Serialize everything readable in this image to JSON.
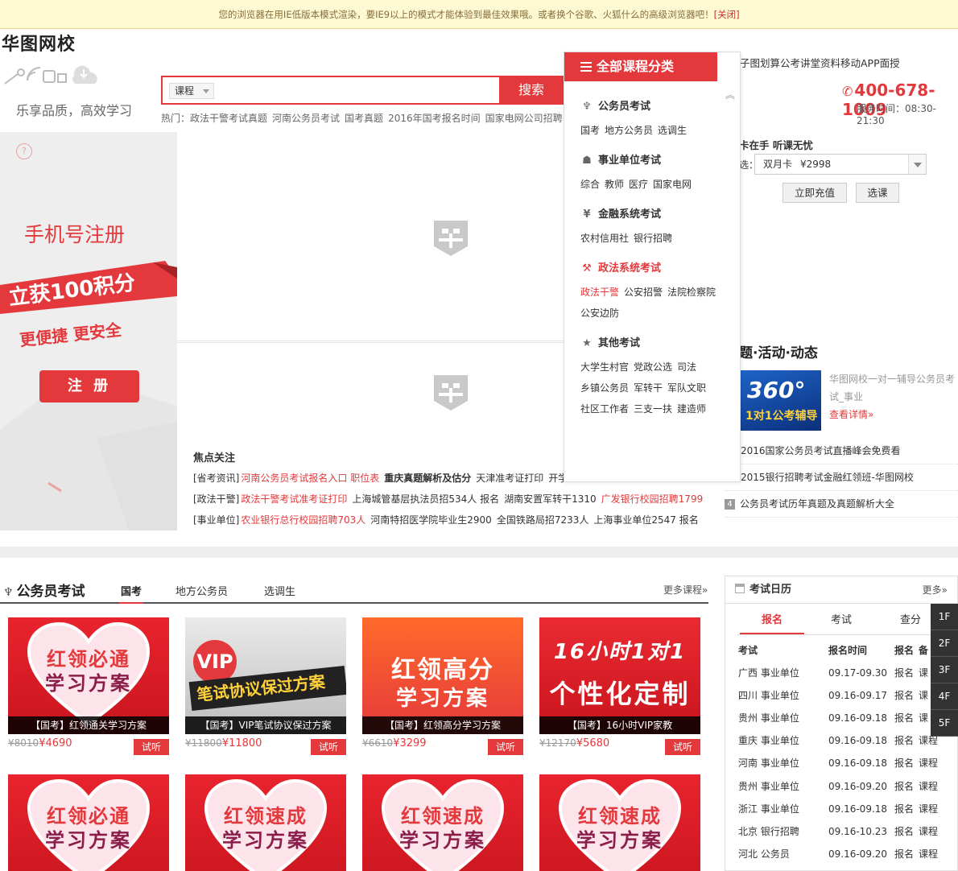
{
  "ie_notice": {
    "text": "您的浏览器在用IE低版本模式渲染，要IE9以上的模式才能体验到最佳效果哦。或者换个谷歌、火狐什么的高级浏览器吧！",
    "close": "[关闭]"
  },
  "site": {
    "name": "华图网校",
    "slogan": "乐享品质，高效学习"
  },
  "search": {
    "select_value": "课程",
    "placeholder": "",
    "button": "搜索"
  },
  "hot": {
    "label": "热门：",
    "items": [
      "政法干警考试真题",
      "河南公务员考试",
      "国考真题",
      "2016年国考报名时间",
      "国家电网公司招聘"
    ]
  },
  "topnav": {
    "text": "子图划算公考讲堂资料移动APP面授"
  },
  "contact": {
    "phone": "400-678-1009",
    "hours": "服务时间：08:30-21:30"
  },
  "banner": {
    "title": "手机号注册",
    "ribbon": "立获100积分",
    "sub": "更便捷 更安全",
    "button": "注 册"
  },
  "dropdown": {
    "header": "全部课程分类",
    "categories": [
      {
        "title": "公务员考试",
        "icon": "tie-icon",
        "items": [
          "国考",
          "地方公务员",
          "选调生"
        ]
      },
      {
        "title": "事业单位考试",
        "icon": "cap-icon",
        "items": [
          "综合",
          "教师",
          "医疗",
          "国家电网"
        ]
      },
      {
        "title": "金融系统考试",
        "icon": "yen-icon",
        "items": [
          "农村信用社",
          "银行招聘"
        ]
      },
      {
        "title": "政法系统考试",
        "icon": "gavel-icon",
        "items": [
          "政法干警",
          "公安招警",
          "法院检察院"
        ],
        "items2": [
          "公安边防"
        ]
      },
      {
        "title": "其他考试",
        "icon": "star-icon",
        "items": [
          "大学生村官",
          "党政公选",
          "司法"
        ],
        "items2": [
          "乡镇公务员",
          "军转干",
          "军队文职"
        ],
        "items3": [
          "社区工作者",
          "三支一扶",
          "建造师"
        ]
      }
    ]
  },
  "focus": {
    "title": "焦点关注",
    "rows": [
      {
        "tag": "[省考资讯]",
        "links": [
          "河南公务员考试报名入口 职位表",
          "重庆真题解析及估分",
          "天津准考证打印",
          "开学"
        ]
      },
      {
        "tag": "[政法干警]",
        "links": [
          "政法干警考试准考证打印",
          "上海城管基层执法员招534人 报名",
          "湖南安置军转干1310",
          "广发银行校园招聘1799"
        ]
      },
      {
        "tag": "[事业单位]",
        "links": [
          "农业银行总行校园招聘703人",
          "河南特招医学院毕业生2900",
          "全国铁路局招7233人",
          "上海事业单位2547 报名"
        ]
      }
    ]
  },
  "account": {
    "line": "卡在手 听课无忧",
    "card_label": "选：",
    "card_name": "双月卡",
    "card_price": "¥2998",
    "btn_recharge": "立即充值",
    "btn_select": "选课"
  },
  "news": {
    "title": "题·活动·动态",
    "img_text1": "360°",
    "img_text2": "1对1公考辅导",
    "desc": "华图网校一对一辅导公务员考试_事业",
    "more": "查看详情»",
    "list": [
      {
        "num": "",
        "text": "2016国家公务员考试直播峰会免费看"
      },
      {
        "num": "",
        "text": "2015银行招聘考试金融红领班-华图网校"
      },
      {
        "num": "4",
        "text": "公务员考试历年真题及真题解析大全"
      }
    ]
  },
  "section": {
    "title": "公务员考试",
    "tabs": [
      "国考",
      "地方公务员",
      "选调生"
    ],
    "more": "更多课程»",
    "courses": [
      {
        "p1": "红领必通",
        "p2": "学习方案",
        "caption": "【国考】红领通关学习方案",
        "old": "¥8010",
        "price": "¥4690",
        "try": "试听",
        "style": "heart"
      },
      {
        "p1": "VIP",
        "p2": "笔试协议保过方案",
        "caption": "【国考】VIP笔试协议保过方案",
        "old": "¥11800",
        "price": "¥11800",
        "try": "试听",
        "style": "vip"
      },
      {
        "p1": "红领高分",
        "p2": "学习方案",
        "caption": "【国考】红领高分学习方案",
        "old": "¥6610",
        "price": "¥3299",
        "try": "试听",
        "style": "orange"
      },
      {
        "p1": "16小时1对1",
        "p2": "个性化定制",
        "caption": "【国考】16小时VIP家教",
        "old": "¥12170",
        "price": "¥5680",
        "try": "试听",
        "style": "red"
      },
      {
        "p1": "红领必通",
        "p2": "学习方案",
        "caption": "",
        "style": "heart"
      },
      {
        "p1": "红领速成",
        "p2": "学习方案",
        "caption": "",
        "style": "heart"
      },
      {
        "p1": "红领速成",
        "p2": "学习方案",
        "caption": "",
        "style": "heart"
      },
      {
        "p1": "红领速成",
        "p2": "学习方案",
        "caption": "",
        "style": "heart"
      }
    ]
  },
  "calendar": {
    "title": "考试日历",
    "more": "更多»",
    "tabs": [
      "报名",
      "考试",
      "查分"
    ],
    "headers": [
      "考试",
      "报名时间",
      "报名",
      "备"
    ],
    "rows": [
      [
        "广西 事业单位",
        "09.17-09.30",
        "报名",
        "课"
      ],
      [
        "四川 事业单位",
        "09.16-09.17",
        "报名",
        "课"
      ],
      [
        "贵州 事业单位",
        "09.16-09.18",
        "报名",
        "课"
      ],
      [
        "重庆 事业单位",
        "09.16-09.18",
        "报名",
        "课程"
      ],
      [
        "河南 事业单位",
        "09.16-09.18",
        "报名",
        "课程"
      ],
      [
        "贵州 事业单位",
        "09.16-09.20",
        "报名",
        "课程"
      ],
      [
        "浙江 事业单位",
        "09.16-09.18",
        "报名",
        "课程"
      ],
      [
        "北京 银行招聘",
        "09.16-10.23",
        "报名",
        "课程"
      ],
      [
        "河北 公务员",
        "09.16-09.20",
        "报名",
        "课程"
      ]
    ]
  },
  "floors": [
    "1F",
    "2F",
    "3F",
    "4F",
    "5F"
  ]
}
